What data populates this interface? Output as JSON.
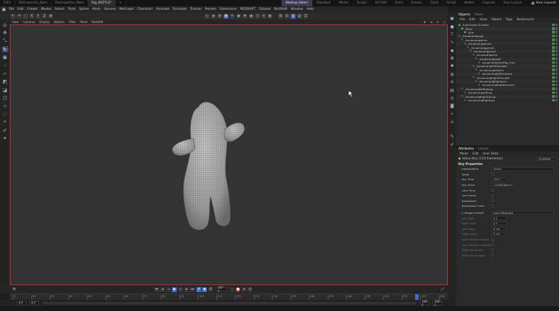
{
  "titlebar": {
    "tabs": [
      {
        "label": "Fil01"
      },
      {
        "label": "FileInspector_Nam"
      },
      {
        "label": "FileInspector_Nam"
      },
      {
        "label": "Rig_BEETLE*",
        "active": true
      },
      {
        "label": "+"
      }
    ],
    "layouts": [
      {
        "label": "Startup (User)",
        "active": true
      },
      {
        "label": "Standard"
      },
      {
        "label": "Model"
      },
      {
        "label": "Sculpt"
      },
      {
        "label": "UV Edit"
      },
      {
        "label": "Paint"
      },
      {
        "label": "Groom"
      },
      {
        "label": "Track"
      },
      {
        "label": "Script"
      },
      {
        "label": "Nodes"
      },
      {
        "label": "Capsule"
      },
      {
        "label": "Gen Layout"
      }
    ],
    "new_layouts": "New Layouts"
  },
  "menubar": {
    "items": [
      "File",
      "Edit",
      "Create",
      "Modes",
      "Select",
      "Tools",
      "Spline",
      "Mesh",
      "Volume",
      "MoGraph",
      "Character",
      "Animate",
      "Simulate",
      "Tracker",
      "Render",
      "Extensions",
      "REDSHIFT",
      "Octane",
      "RedShift",
      "Window",
      "Help"
    ]
  },
  "viewport_menu": {
    "items": [
      "View",
      "Cameras",
      "Display",
      "Options",
      "Filter",
      "Panel",
      "RedshIft"
    ]
  },
  "timeline": {
    "current_frame": "187 F",
    "start_frame": "0 F",
    "end_frame": "150 F",
    "min_frame": "0 F",
    "max_frame": "150 F",
    "ruler_ticks": [
      "0",
      "10",
      "20",
      "30",
      "40",
      "50",
      "60",
      "70",
      "80",
      "90",
      "100",
      "110",
      "120",
      "130",
      "140",
      "150",
      "160",
      "170",
      "180",
      "190",
      "200",
      "210",
      "220",
      "230"
    ]
  },
  "objects_panel": {
    "tabs": [
      {
        "label": "Objects",
        "active": true
      },
      {
        "label": "Takes"
      }
    ],
    "menu": [
      "File",
      "Edit",
      "View",
      "Object",
      "Tags",
      "Bookmarks"
    ],
    "items": [
      {
        "label": "Subdivision Surface",
        "depth": 0
      },
      {
        "label": "Mesh",
        "depth": 1
      },
      {
        "label": "Skin",
        "depth": 2
      },
      {
        "label": "visuamorigcoge",
        "depth": 0
      },
      {
        "label": "visuamorigsplne",
        "depth": 1
      },
      {
        "label": "visuamorigspine1",
        "depth": 2
      },
      {
        "label": "visuamorigspine2",
        "depth": 3
      },
      {
        "label": "visuamorigchest",
        "depth": 4
      },
      {
        "label": "visuamorigneck",
        "depth": 5
      },
      {
        "label": "visuamorighead",
        "depth": 6
      },
      {
        "label": "visuamorigHeadTop_End",
        "depth": 7
      },
      {
        "label": "visuamorigleftShoulder",
        "depth": 5
      },
      {
        "label": "visuamorigleftArm",
        "depth": 6
      },
      {
        "label": "visuamorigleftForeArm",
        "depth": 7
      },
      {
        "label": "visuamorigRightShoulder",
        "depth": 5
      },
      {
        "label": "visuamorigRightArm",
        "depth": 6
      },
      {
        "label": "visuamorigRightForeArm",
        "depth": 7
      },
      {
        "label": "visuamorigleftUpLeg",
        "depth": 1
      },
      {
        "label": "visuamorigleftLeg",
        "depth": 2
      },
      {
        "label": "visuamorigRightUpLeg",
        "depth": 1
      },
      {
        "label": "visuamorigRightLeg",
        "depth": 2
      }
    ]
  },
  "attributes_panel": {
    "tabs": [
      {
        "label": "Attributes",
        "active": true
      },
      {
        "label": "Layers"
      }
    ],
    "menu": [
      "Mode",
      "Edit",
      "User Data"
    ],
    "header": "Value Key (110 Elements)",
    "dropdown": "Custom",
    "section": "Key Properties",
    "interpolation_label": "Interpolation",
    "interpolation_value": "Spline",
    "rows": [
      {
        "label": "Value",
        "type": "check"
      },
      {
        "label": "Key Time",
        "value": "150 F"
      },
      {
        "label": "Key Value",
        "value": "<<Multiple>>"
      },
      {
        "label": "Lock Time",
        "type": "check"
      },
      {
        "label": "Lock Value",
        "type": "check"
      },
      {
        "label": "Breakdown",
        "type": "check"
      },
      {
        "label": "Breakdown Color",
        "type": "check"
      }
    ],
    "tangent_label": "Tangent Preset",
    "tangent_value": "Auto Weighted",
    "tangent_rows": [
      {
        "label": "Left Time",
        "value": "0 F"
      },
      {
        "label": "Right Time",
        "value": "0 F"
      },
      {
        "label": "Left Value",
        "value": "0 cm"
      },
      {
        "label": "Right Value",
        "value": "0 cm"
      },
      {
        "label": "Lock Tangent Angles",
        "type": "check"
      },
      {
        "label": "Lock Tangent Lengths",
        "type": "check"
      },
      {
        "label": "Break Tangents",
        "type": "check"
      },
      {
        "label": "Keep Visual Angle",
        "type": "check"
      }
    ]
  },
  "colors": {
    "accent": "#4858a8",
    "viewport_border": "#bb3333",
    "record": "#c03030"
  }
}
